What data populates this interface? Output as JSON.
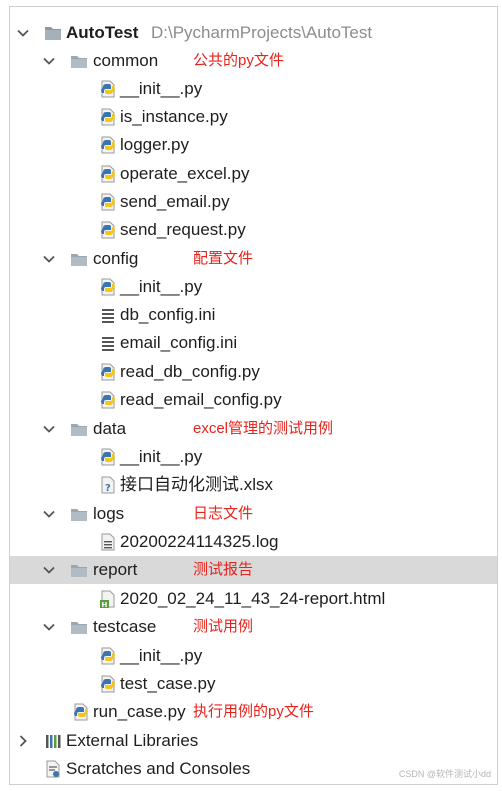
{
  "tree": {
    "root": {
      "label": "AutoTest",
      "path": "D:\\PycharmProjects\\AutoTest"
    },
    "common": {
      "label": "common",
      "note": "公共的py文件",
      "files": [
        "__init__.py",
        "is_instance.py",
        "logger.py",
        "operate_excel.py",
        "send_email.py",
        "send_request.py"
      ]
    },
    "config": {
      "label": "config",
      "note": "配置文件",
      "files": [
        "__init__.py",
        "db_config.ini",
        "email_config.ini",
        "read_db_config.py",
        "read_email_config.py"
      ]
    },
    "data": {
      "label": "data",
      "note": "excel管理的测试用例",
      "files": [
        "__init__.py",
        "接口自动化测试.xlsx"
      ]
    },
    "logs": {
      "label": "logs",
      "note": "日志文件",
      "files": [
        "20200224114325.log"
      ]
    },
    "report": {
      "label": "report",
      "note": "测试报告",
      "files": [
        "2020_02_24_11_43_24-report.html"
      ]
    },
    "testcase": {
      "label": "testcase",
      "note": "测试用例",
      "files": [
        "__init__.py",
        "test_case.py"
      ]
    },
    "run_case": {
      "label": "run_case.py",
      "note": "执行用例的py文件"
    },
    "external": {
      "label": "External Libraries"
    },
    "scratches": {
      "label": "Scratches and Consoles"
    }
  },
  "watermark": "CSDN @软件测试小dd",
  "colors": {
    "annotation": "#e8231c",
    "selected_row": "#d9d9d9",
    "path_gray": "#8c8c8c"
  }
}
